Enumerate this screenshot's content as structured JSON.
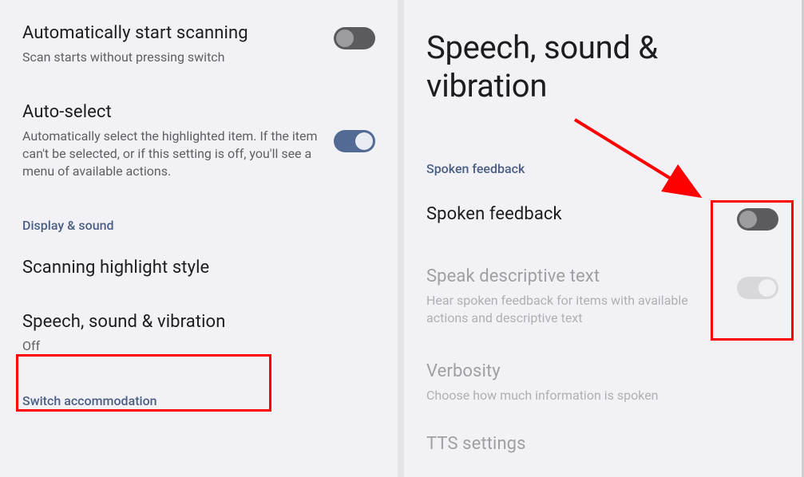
{
  "left": {
    "auto_scan": {
      "title": "Automatically start scanning",
      "subtitle": "Scan starts without pressing switch",
      "on": false
    },
    "auto_select": {
      "title": "Auto-select",
      "subtitle": "Automatically select the highlighted item. If the item can't be selected, or if this setting is off, you'll see a menu of available actions.",
      "on": true
    },
    "section_display_sound": "Display & sound",
    "highlight_style": {
      "title": "Scanning highlight style"
    },
    "speech_sound_vib": {
      "title": "Speech, sound & vibration",
      "subtitle": "Off"
    },
    "section_switch_accom": "Switch accommodation"
  },
  "right": {
    "page_title": "Speech, sound & vibration",
    "section_spoken_feedback": "Spoken feedback",
    "spoken_feedback": {
      "title": "Spoken feedback",
      "on": false
    },
    "speak_descriptive": {
      "title": "Speak descriptive text",
      "subtitle": "Hear spoken feedback for items with available actions and descriptive text",
      "on": false,
      "disabled": true
    },
    "verbosity": {
      "title": "Verbosity",
      "subtitle": "Choose how much information is spoken",
      "disabled": true
    },
    "tts": {
      "title": "TTS settings",
      "disabled": true
    }
  }
}
